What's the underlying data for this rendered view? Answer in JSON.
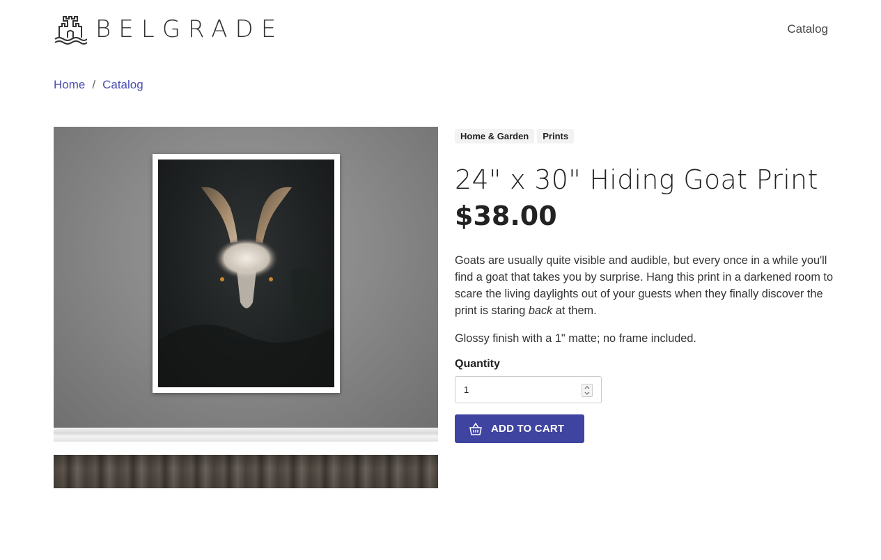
{
  "header": {
    "brand": "BELGRADE",
    "nav_catalog": "Catalog"
  },
  "breadcrumb": {
    "home": "Home",
    "separator": "/",
    "catalog": "Catalog"
  },
  "product": {
    "tags": [
      "Home & Garden",
      "Prints"
    ],
    "title": "24\" x 30\" Hiding Goat Print",
    "price": "$38.00",
    "description_before": "Goats are usually quite visible and audible, but every once in a while you'll find a goat that takes you by surprise. Hang this print in a darkened room to scare the living daylights out of your guests when they finally discover the print is staring ",
    "description_em": "back",
    "description_after": " at them.",
    "finish": "Glossy finish with a 1\" matte; no frame included.",
    "quantity_label": "Quantity",
    "quantity_value": "1",
    "add_to_cart_label": "ADD TO CART"
  },
  "icons": {
    "logo": "castle-icon",
    "cart": "basket-icon",
    "stepper": "chevron-up-down-icon"
  },
  "colors": {
    "accent": "#3f44a0",
    "link": "#4a4fb0"
  }
}
